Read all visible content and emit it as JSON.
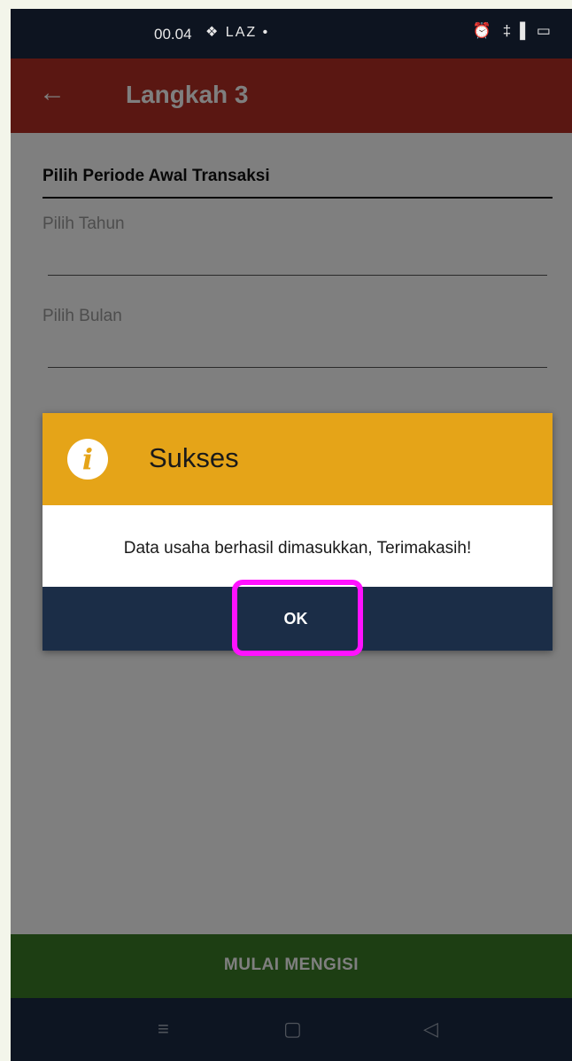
{
  "status_bar": {
    "time": "00.04",
    "left_icons": "❖ LAZ •",
    "right_icons": "⏰ ‡▐ ▭"
  },
  "app_bar": {
    "back_icon": "←",
    "title": "Langkah 3"
  },
  "form": {
    "section_label": "Pilih Periode Awal Transaksi",
    "year_placeholder": "Pilih Tahun",
    "month_placeholder": "Pilih Bulan"
  },
  "dialog": {
    "icon_glyph": "i",
    "title": "Sukses",
    "message": "Data usaha berhasil dimasukkan, Terimakasih!",
    "ok_label": "OK"
  },
  "bottom_button": {
    "label": "MULAI MENGISI"
  },
  "nav_bar": {
    "menu_icon": "≡",
    "home_icon": "▢",
    "back_icon": "◁"
  },
  "colors": {
    "app_bar": "#b52f24",
    "dialog_header": "#e5a418",
    "dialog_footer": "#1b2d47",
    "bottom_button": "#3a7d27",
    "highlight": "#ff12ff"
  }
}
